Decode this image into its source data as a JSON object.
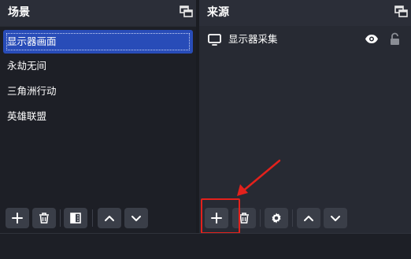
{
  "scenes": {
    "title": "场景",
    "items": [
      {
        "label": "显示器画面",
        "selected": true
      },
      {
        "label": "永劫无间",
        "selected": false
      },
      {
        "label": "三角洲行动",
        "selected": false
      },
      {
        "label": "英雄联盟",
        "selected": false
      }
    ]
  },
  "sources": {
    "title": "来源",
    "items": [
      {
        "label": "显示器采集",
        "visible": true,
        "locked": false
      }
    ]
  },
  "colors": {
    "selection": "#284cb8",
    "panel": "#272a33",
    "list_bg": "#1d1f26",
    "button_bg": "#3a3e48",
    "annotation_red": "#e3211c"
  },
  "icons": [
    "float-icon",
    "add-icon",
    "trash-icon",
    "filter-icon",
    "arrow-up-icon",
    "arrow-down-icon",
    "monitor-icon",
    "eye-icon",
    "lock-icon",
    "gear-icon"
  ]
}
